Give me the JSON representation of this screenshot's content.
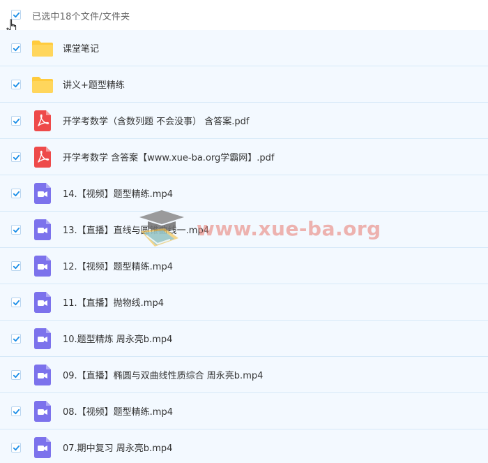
{
  "header": {
    "summary": "已选中18个文件/文件夹",
    "checked": true
  },
  "colors": {
    "accent": "#1a8ee8",
    "row_bg": "#f3f9ff",
    "row_border": "#d6e9f8",
    "folder": "#ffcb3d",
    "pdf": "#ee4a4a",
    "video": "#7c72ec"
  },
  "files": [
    {
      "name": "课堂笔记",
      "icon": "folder-icon"
    },
    {
      "name": "讲义+题型精练",
      "icon": "folder-icon"
    },
    {
      "name": "开学考数学（含数列题 不会没事） 含答案.pdf",
      "icon": "pdf-icon"
    },
    {
      "name": "开学考数学 含答案【www.xue-ba.org学霸网】.pdf",
      "icon": "pdf-icon"
    },
    {
      "name": "14.【视频】题型精练.mp4",
      "icon": "video-icon"
    },
    {
      "name": "13.【直播】直线与圆锥曲线一.mp4",
      "icon": "video-icon"
    },
    {
      "name": "12.【视频】题型精练.mp4",
      "icon": "video-icon"
    },
    {
      "name": "11.【直播】抛物线.mp4",
      "icon": "video-icon"
    },
    {
      "name": "10.题型精炼 周永亮b.mp4",
      "icon": "video-icon"
    },
    {
      "name": "09.【直播】椭圆与双曲线性质综合 周永亮b.mp4",
      "icon": "video-icon"
    },
    {
      "name": "08.【视频】题型精练.mp4",
      "icon": "video-icon"
    },
    {
      "name": "07.期中复习 周永亮b.mp4",
      "icon": "video-icon"
    }
  ],
  "watermark": {
    "text": "www.xue-ba.org"
  }
}
